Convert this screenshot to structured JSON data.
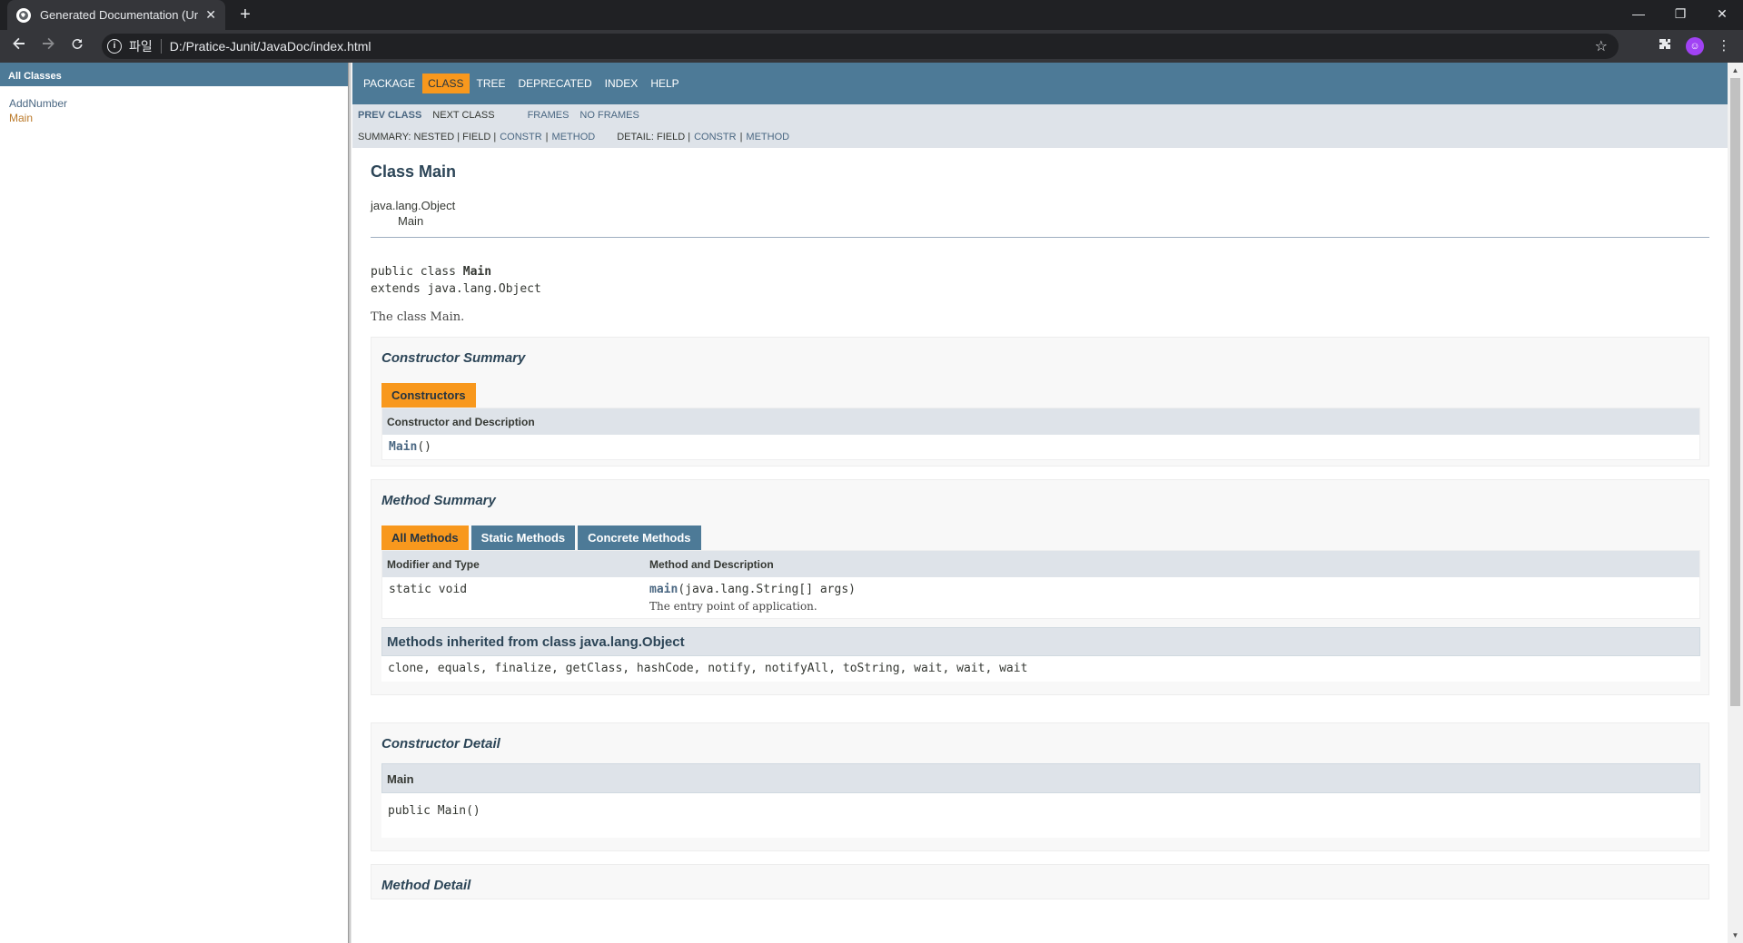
{
  "browser": {
    "tab_title": "Generated Documentation (Untitled)",
    "tab_close": "✕",
    "new_tab": "+",
    "scheme_label": "파일",
    "url": "D:/Pratice-Junit/JavaDoc/index.html",
    "window_controls": {
      "minimize": "—",
      "restore": "❐",
      "close": "✕"
    }
  },
  "left": {
    "header": "All Classes",
    "classes": [
      {
        "label": "AddNumber"
      },
      {
        "label": "Main"
      }
    ]
  },
  "nav": {
    "items": [
      "PACKAGE",
      "CLASS",
      "TREE",
      "DEPRECATED",
      "INDEX",
      "HELP"
    ],
    "prev_class": "PREV CLASS",
    "next_class": "NEXT CLASS",
    "frames": "FRAMES",
    "no_frames": "NO FRAMES",
    "summary_prefix": "SUMMARY: NESTED | FIELD |",
    "summary_constr": "CONSTR",
    "summary_sep": "|",
    "summary_method": "METHOD",
    "detail_prefix": "DETAIL: FIELD |",
    "detail_constr": "CONSTR",
    "detail_sep": "|",
    "detail_method": "METHOD"
  },
  "doc": {
    "class_title": "Class Main",
    "inherit_parent": "java.lang.Object",
    "inherit_child": "Main",
    "sig_prefix": "public class ",
    "sig_name": "Main",
    "sig_extends": "extends java.lang.Object",
    "description": "The class Main.",
    "constructor_summary": {
      "title": "Constructor Summary",
      "tab": "Constructors",
      "header": "Constructor and Description",
      "row_name": "Main",
      "row_args": "()"
    },
    "method_summary": {
      "title": "Method Summary",
      "tabs": [
        "All Methods",
        "Static Methods",
        "Concrete Methods"
      ],
      "headers": [
        "Modifier and Type",
        "Method and Description"
      ],
      "row_modifier": "static void",
      "row_name": "main",
      "row_args": "(java.lang.String[] args)",
      "row_desc": "The entry point of application.",
      "inherited_title": "Methods inherited from class java.lang.Object",
      "inherited_methods": "clone, equals, finalize, getClass, hashCode, notify, notifyAll, toString, wait, wait, wait"
    },
    "constructor_detail": {
      "title": "Constructor Detail",
      "header": "Main",
      "signature": "public Main()"
    },
    "method_detail": {
      "title": "Method Detail"
    }
  }
}
